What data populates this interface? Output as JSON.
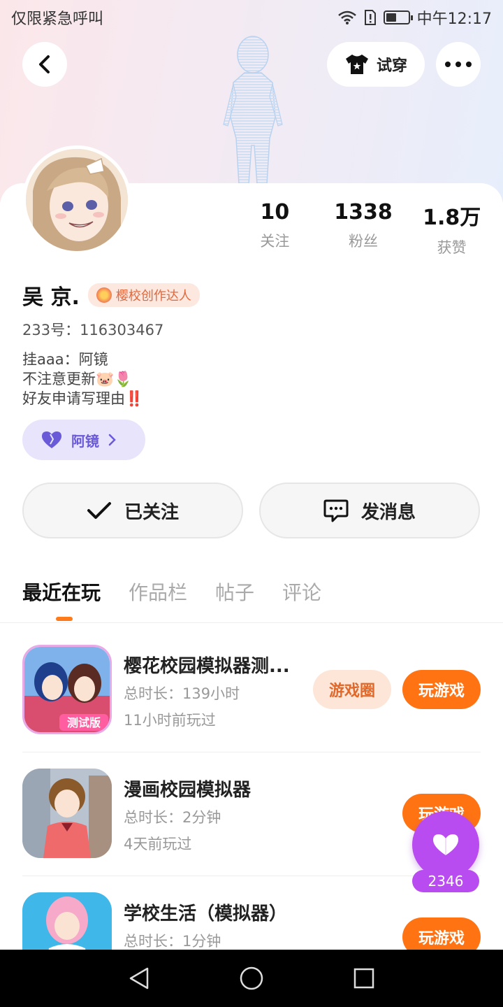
{
  "status_bar": {
    "carrier_text": "仅限紧急呼叫",
    "time": "中午12:17"
  },
  "header": {
    "tryon_label": "试穿"
  },
  "profile": {
    "name": "吴 京.",
    "badge": "樱校创作达人",
    "uid": "233号：116303467",
    "bio": [
      "挂aaa：阿镜",
      "不注意更新🐷🌷",
      "好友申请写理由‼️"
    ],
    "chip_label": "阿镜",
    "stats": [
      {
        "value": "10",
        "label": "关注"
      },
      {
        "value": "1338",
        "label": "粉丝"
      },
      {
        "value": "1.8万",
        "label": "获赞"
      }
    ]
  },
  "actions": {
    "follow_label": "已关注",
    "message_label": "发消息"
  },
  "tabs": [
    "最近在玩",
    "作品栏",
    "帖子",
    "评论"
  ],
  "games": [
    {
      "name": "樱花校园模拟器测...",
      "duration": "总时长：139小时",
      "last_played": "11小时前玩过",
      "circle_label": "游戏圈",
      "play_label": "玩游戏",
      "icon_tag": "测试版"
    },
    {
      "name": "漫画校园模拟器",
      "duration": "总时长：2分钟",
      "last_played": "4天前玩过",
      "play_label": "玩游戏"
    },
    {
      "name": "学校生活（模拟器）",
      "duration": "总时长：1分钟",
      "play_label": "玩游戏"
    }
  ],
  "like_float": {
    "count": "2346"
  },
  "colors": {
    "accent_orange": "#ff7313",
    "like_purple": "#b94cf0",
    "chip_purple": "#6a5ad8"
  }
}
